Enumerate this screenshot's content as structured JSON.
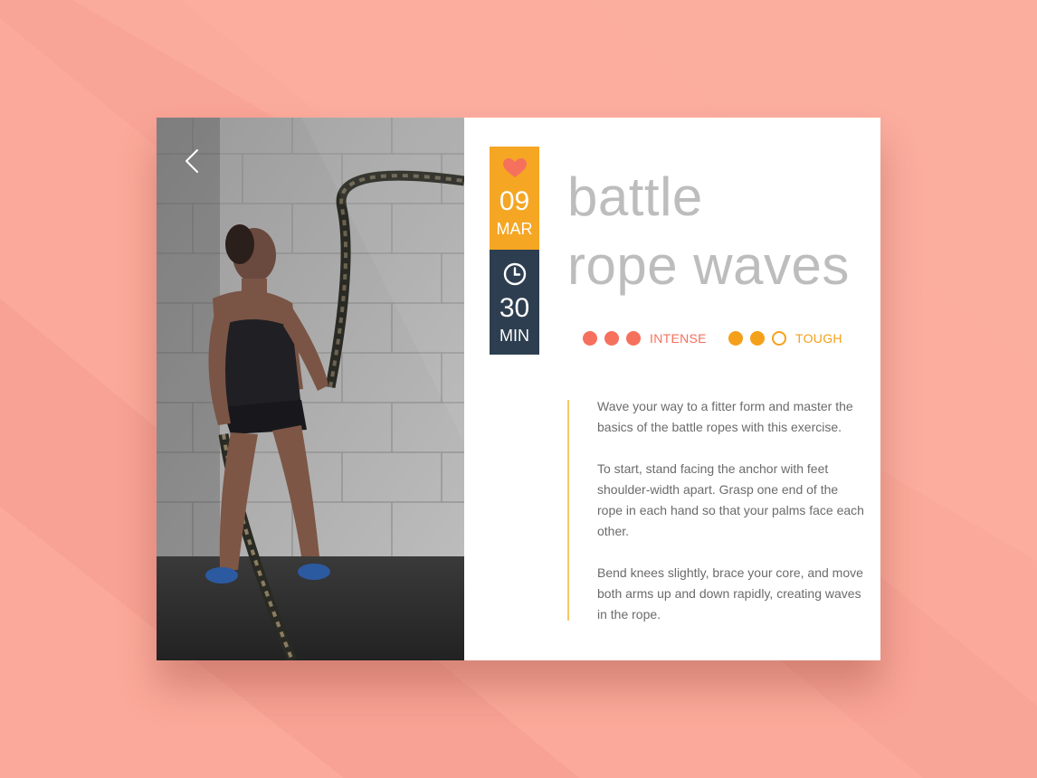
{
  "colors": {
    "background": "#fba99a",
    "date_block": "#f5a623",
    "time_block": "#2d3e50",
    "intense": "#f6705e",
    "tough": "#f5a01a",
    "title": "#bdbdbd",
    "body_text": "#6b6b6b"
  },
  "nav": {
    "back_icon": "chevron-left-icon"
  },
  "workout": {
    "date": {
      "icon": "heart-icon",
      "day": "09",
      "month": "MAR"
    },
    "duration": {
      "icon": "clock-icon",
      "value": "30",
      "unit": "MIN"
    },
    "title_line1": "battle",
    "title_line2": "rope waves",
    "intensity": {
      "label": "INTENSE",
      "filled": 3,
      "total": 3
    },
    "difficulty": {
      "label": "TOUGH",
      "filled": 2,
      "total": 3
    },
    "description": [
      "Wave your way to a fitter form and master the basics of the battle ropes with this exercise.",
      "To start, stand facing the anchor with feet shoulder-width apart. Grasp one end of the rope in each hand so that your palms face each other.",
      "Bend knees slightly, brace your core, and move both arms up and down rapidly, creating waves in the rope."
    ]
  }
}
